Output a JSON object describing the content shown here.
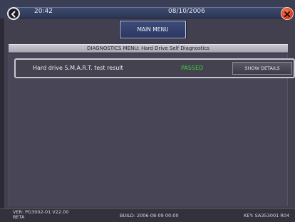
{
  "header": {
    "time": "20:42",
    "date": "08/10/2006",
    "back_icon": "back-arrow-icon",
    "close_icon": "close-x-icon"
  },
  "nav": {
    "main_menu_label": "MAIN MENU"
  },
  "diagnostics": {
    "title": "DIAGNOSTICS MENU:  Hard Drive Self Diagnostics",
    "results": [
      {
        "label": "Hard drive S.M.A.R.T. test result",
        "status": "PASSED",
        "action_label": "SHOW DETAILS"
      }
    ]
  },
  "footer": {
    "ver_label": "VER:  PG3002-01 V22.00\nBETA",
    "build_label": "BUILD:  2006-08-09  00:00",
    "key_label": "KEY:  SA353001 R04"
  },
  "colors": {
    "status_pass": "#3bd33b",
    "close_button": "#e0401d",
    "header_strip": "#2d3656"
  }
}
